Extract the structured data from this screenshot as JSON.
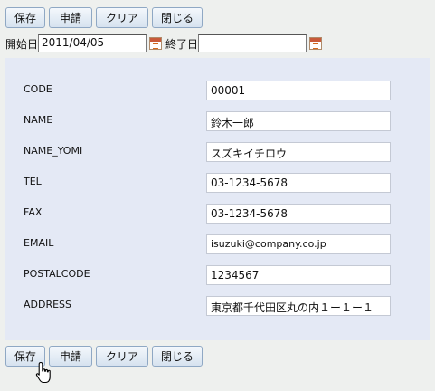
{
  "toolbar": {
    "save": "保存",
    "apply": "申請",
    "clear": "クリア",
    "close": "閉じる"
  },
  "dates": {
    "start_label": "開始日",
    "start_value": "2011/04/05",
    "end_label": "終了日",
    "end_value": ""
  },
  "fields": {
    "code": {
      "label": "CODE",
      "value": "00001"
    },
    "name": {
      "label": "NAME",
      "value": "鈴木一郎"
    },
    "name_yomi": {
      "label": "NAME_YOMI",
      "value": "スズキイチロウ"
    },
    "tel": {
      "label": "TEL",
      "value": "03-1234-5678"
    },
    "fax": {
      "label": "FAX",
      "value": "03-1234-5678"
    },
    "email": {
      "label": "EMAIL",
      "value": "isuzuki@company.co.jp"
    },
    "postalcode": {
      "label": "POSTALCODE",
      "value": "1234567"
    },
    "address": {
      "label": "ADDRESS",
      "value": "東京都千代田区丸の内１ー１ー１"
    }
  }
}
